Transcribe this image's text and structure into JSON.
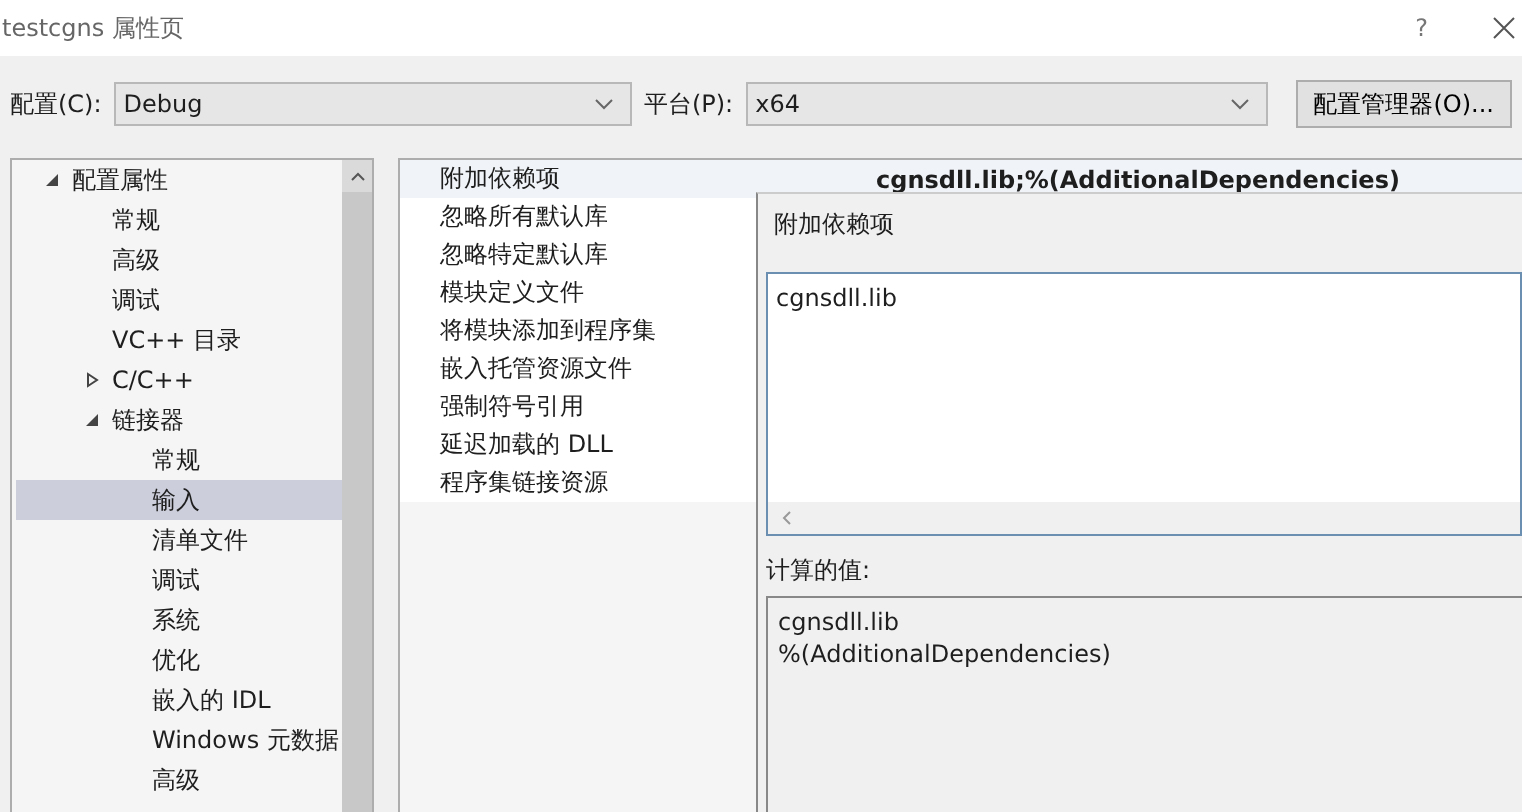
{
  "window": {
    "title": "testcgns 属性页",
    "help_button": "?"
  },
  "toolbar": {
    "configuration_label": "配置(C):",
    "configuration": "Debug",
    "platform_label": "平台(P):",
    "platform": "x64",
    "manager_button": "配置管理器(O)..."
  },
  "tree": [
    {
      "label": "配置属性",
      "expanded": true,
      "selected": false,
      "children": [
        {
          "label": "常规",
          "selected": false
        },
        {
          "label": "高级",
          "selected": false
        },
        {
          "label": "调试",
          "selected": false
        },
        {
          "label": "VC++ 目录",
          "selected": false
        },
        {
          "label": "C/C++",
          "expanded": false,
          "selected": false
        },
        {
          "label": "链接器",
          "expanded": true,
          "selected": false,
          "children": [
            {
              "label": "常规",
              "selected": false
            },
            {
              "label": "输入",
              "selected": true
            },
            {
              "label": "清单文件",
              "selected": false
            },
            {
              "label": "调试",
              "selected": false
            },
            {
              "label": "系统",
              "selected": false
            },
            {
              "label": "优化",
              "selected": false
            },
            {
              "label": "嵌入的 IDL",
              "selected": false
            },
            {
              "label": "Windows 元数据",
              "selected": false
            },
            {
              "label": "高级",
              "selected": false
            }
          ]
        }
      ]
    }
  ],
  "properties": [
    {
      "name": "附加依赖项",
      "value": "cgnsdll.lib;%(AdditionalDependencies)",
      "selected": true
    },
    {
      "name": "忽略所有默认库",
      "selected": false
    },
    {
      "name": "忽略特定默认库",
      "selected": false
    },
    {
      "name": "模块定义文件",
      "selected": false
    },
    {
      "name": "将模块添加到程序集",
      "selected": false
    },
    {
      "name": "嵌入托管资源文件",
      "selected": false
    },
    {
      "name": "强制符号引用",
      "selected": false
    },
    {
      "name": "延迟加载的 DLL",
      "selected": false
    },
    {
      "name": "程序集链接资源",
      "selected": false
    }
  ],
  "editor": {
    "title": "附加依赖项",
    "value": "cgnsdll.lib",
    "computed_label": "计算的值:",
    "computed_lines": [
      "cgnsdll.lib",
      "%(AdditionalDependencies)"
    ]
  }
}
